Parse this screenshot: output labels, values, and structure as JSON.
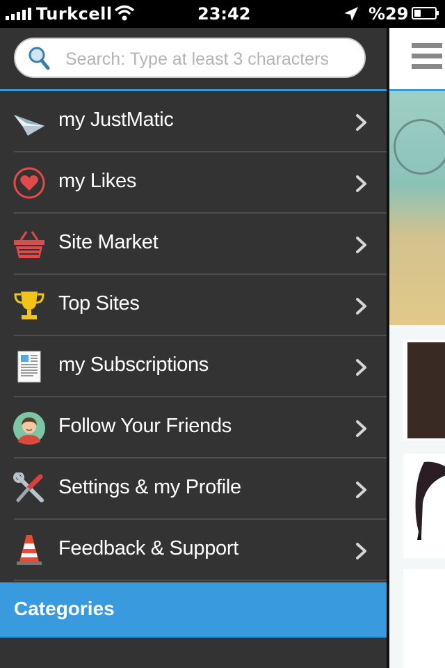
{
  "status_bar": {
    "carrier": "Turkcell",
    "time": "23:42",
    "battery": "%29"
  },
  "search": {
    "placeholder": "Search: Type at least 3 characters"
  },
  "menu": {
    "items": [
      {
        "label": "my JustMatic",
        "icon": "paper-plane-icon"
      },
      {
        "label": "my Likes",
        "icon": "heart-icon"
      },
      {
        "label": "Site Market",
        "icon": "basket-icon"
      },
      {
        "label": "Top Sites",
        "icon": "trophy-icon"
      },
      {
        "label": "my Subscriptions",
        "icon": "newspaper-icon"
      },
      {
        "label": "Follow Your Friends",
        "icon": "friend-avatar-icon"
      },
      {
        "label": "Settings & my Profile",
        "icon": "tools-icon"
      },
      {
        "label": "Feedback & Support",
        "icon": "traffic-cone-icon"
      }
    ]
  },
  "categories": {
    "title": "Categories"
  },
  "colors": {
    "drawer_bg": "#333333",
    "accent_blue": "#3a9ade"
  }
}
